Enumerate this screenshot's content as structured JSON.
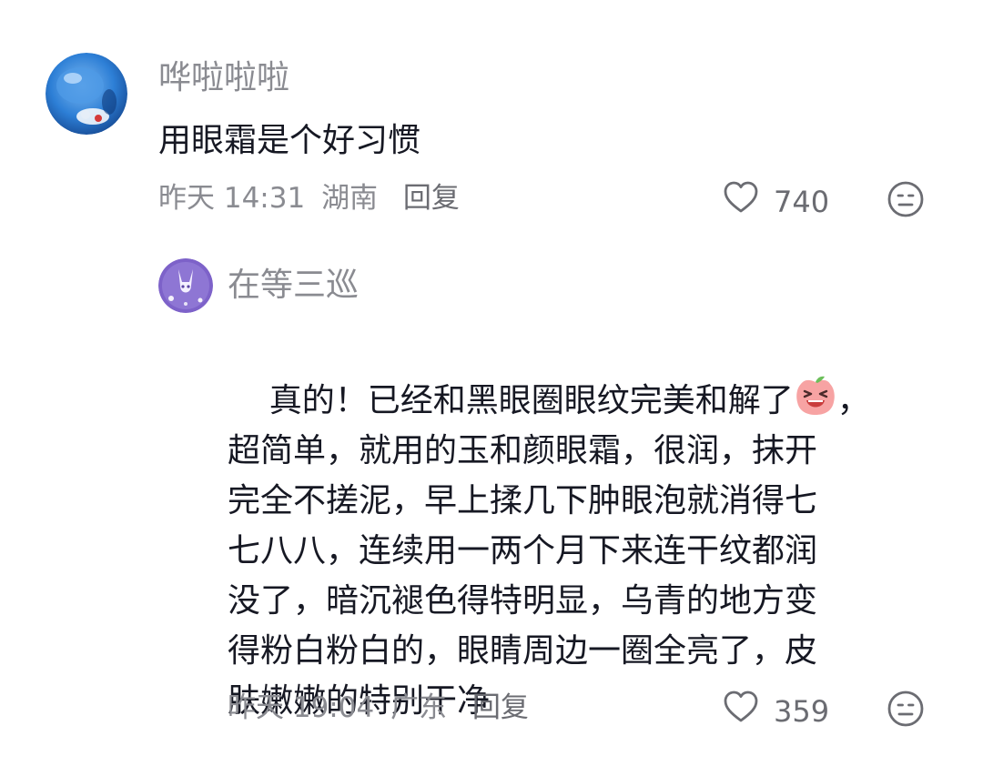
{
  "comments": [
    {
      "username": "哗啦啦啦",
      "text": "用眼霜是个好习惯",
      "time": "昨天 14:31",
      "location": "湖南",
      "reply_label": "回复",
      "likes": "740"
    },
    {
      "username": "在等三巡",
      "text_before_emoji": "真的！已经和黑眼圈眼纹完美和解了",
      "text_after_emoji": "，",
      "text_rest": "超简单，就用的玉和颜眼霜，很润，抹开\n完全不搓泥，早上揉几下肿眼泡就消得七\n七八八，连续用一两个月下来连干纹都润\n没了，暗沉褪色得特明显，乌青的地方变\n得粉白粉白的，眼睛周边一圈全亮了，皮\n肤嫩嫩的特别干净",
      "inline_emoji": "laughing-peach-emoji",
      "time": "昨天 19:04",
      "location": "广东",
      "reply_label": "回复",
      "likes": "359"
    }
  ],
  "icons": {
    "like": "heart-outline-icon",
    "emoji_reaction": "smiley-face-icon"
  },
  "colors": {
    "username": "#8a8b91",
    "text": "#161823",
    "meta": "#8a8b91",
    "icon": "#6b6c72"
  }
}
